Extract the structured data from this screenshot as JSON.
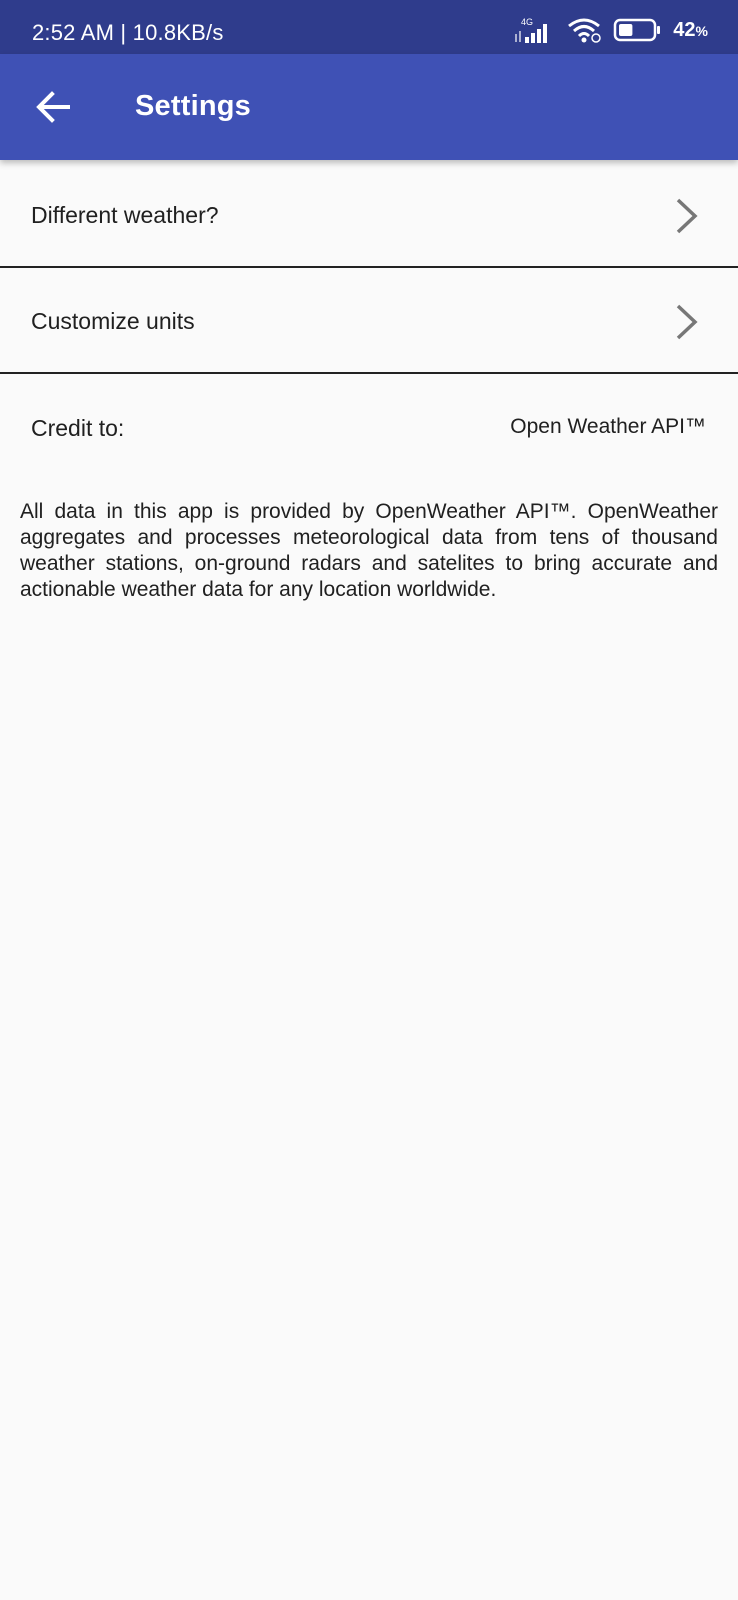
{
  "status_bar": {
    "time": "2:52 AM | 10.8KB/s",
    "network_label": "4G",
    "battery_value": "42",
    "battery_unit": "%",
    "battery_level": 0.42,
    "icons": [
      "signal-icon",
      "wifi-icon",
      "battery-icon"
    ]
  },
  "app_bar": {
    "back_icon": "arrow-left-icon",
    "title": "Settings",
    "color": "#3f51b5"
  },
  "settings_items": [
    {
      "label": "Different weather?",
      "icon": "chevron-right-icon"
    },
    {
      "label": "Customize units",
      "icon": "chevron-right-icon"
    }
  ],
  "credit": {
    "label": "Credit to:",
    "value": "Open Weather API™"
  },
  "description": "All data in this app is provided by OpenWeather API™. OpenWeather aggregates and processes meteorological data from tens of thousand weather stations, on-ground radars and satelites to bring accurate and actionable weather data for any location worldwide."
}
